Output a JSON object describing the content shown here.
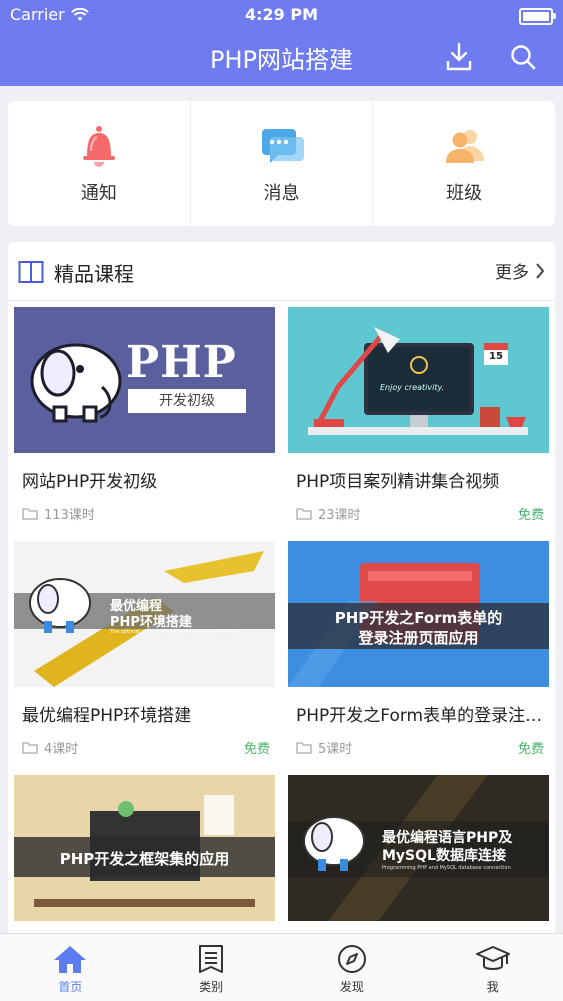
{
  "status": {
    "carrier": "Carrier",
    "time": "4:29 PM"
  },
  "header": {
    "title": "PHP网站搭建"
  },
  "quick": [
    {
      "label": "通知",
      "icon": "bell-icon"
    },
    {
      "label": "消息",
      "icon": "chat-icon"
    },
    {
      "label": "班级",
      "icon": "users-icon"
    }
  ],
  "section": {
    "title": "精品课程",
    "more": "更多"
  },
  "thumbs": {
    "c1_brand": "PHP",
    "c1_sub": "开发初级",
    "c2_slogan": "Enjoy creativity.",
    "c2_date": "15",
    "c3_line1": "最优编程",
    "c3_line2": "PHP环境搭建",
    "c3_small": "The optimal programming PHP environment set up",
    "c4_line1": "PHP开发之Form表单的",
    "c4_line2": "登录注册页面应用",
    "c5_line": "PHP开发之框架集的应用",
    "c6_line1": "最优编程语言PHP及",
    "c6_line2": "MySQL数据库连接",
    "c6_small": "Programming PHP and MySQL database connection"
  },
  "courses": [
    {
      "title": "网站PHP开发初级",
      "lessons": "113课时",
      "free": ""
    },
    {
      "title": "PHP项目案列精讲集合视频",
      "lessons": "23课时",
      "free": "免费"
    },
    {
      "title": "最优编程PHP环境搭建",
      "lessons": "4课时",
      "free": "免费"
    },
    {
      "title": "PHP开发之Form表单的登录注册页面应用",
      "lessons": "5课时",
      "free": "免费"
    }
  ],
  "tabs": [
    {
      "label": "首页",
      "icon": "home-icon"
    },
    {
      "label": "类别",
      "icon": "list-icon"
    },
    {
      "label": "发现",
      "icon": "compass-icon"
    },
    {
      "label": "我",
      "icon": "graduation-cap-icon"
    }
  ],
  "colors": {
    "primary": "#6f7cf0",
    "free": "#46b36b",
    "active_tab": "#5b7df0"
  }
}
